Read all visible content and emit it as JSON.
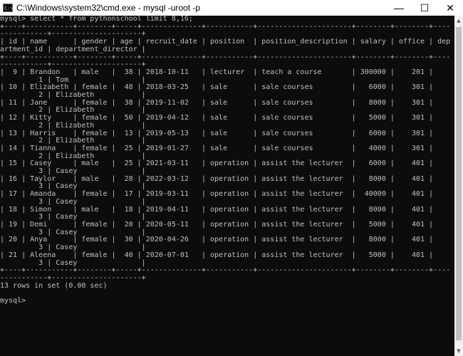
{
  "window": {
    "title": "C:\\Windows\\system32\\cmd.exe - mysql  -uroot -p",
    "icon_text": "C:\\",
    "minimize_glyph": "—",
    "maximize_glyph": "☐",
    "close_glyph": "✕"
  },
  "console": {
    "prompt": "mysql>",
    "command": "select * from pythonschool limit 8,16;",
    "columns": [
      "id",
      "name",
      "gender",
      "age",
      "recruit_date",
      "position",
      "position_description",
      "salary",
      "office",
      "department_id",
      "department_director"
    ],
    "rows": [
      [
        "9",
        "Brandon",
        "male",
        "38",
        "2018-10-11",
        "lecturer",
        "teach a course",
        "300000",
        "201",
        "1",
        "Tom"
      ],
      [
        "10",
        "Elizabeth",
        "female",
        "48",
        "2018-03-25",
        "sale",
        "sale courses",
        "6000",
        "301",
        "2",
        "Elizabeth"
      ],
      [
        "11",
        "Jane",
        "female",
        "38",
        "2019-11-02",
        "sale",
        "sale courses",
        "8000",
        "301",
        "2",
        "Elizabeth"
      ],
      [
        "12",
        "Kitty",
        "female",
        "50",
        "2019-04-12",
        "sale",
        "sale courses",
        "5000",
        "301",
        "2",
        "Elizabeth"
      ],
      [
        "13",
        "Harris",
        "female",
        "13",
        "2019-05-13",
        "sale",
        "sale courses",
        "6000",
        "301",
        "2",
        "Elizabeth"
      ],
      [
        "14",
        "Tianna",
        "female",
        "25",
        "2019-01-27",
        "sale",
        "sale courses",
        "4000",
        "301",
        "2",
        "Elizabeth"
      ],
      [
        "15",
        "Casey",
        "male",
        "25",
        "2021-03-11",
        "operation",
        "assist the lecturer",
        "6000",
        "401",
        "3",
        "Casey"
      ],
      [
        "16",
        "Taylor",
        "male",
        "28",
        "2022-03-12",
        "operation",
        "assist the lecturer",
        "8000",
        "401",
        "3",
        "Casey"
      ],
      [
        "17",
        "Amanda",
        "female",
        "17",
        "2019-03-11",
        "operation",
        "assist the lecturer",
        "40000",
        "401",
        "3",
        "Casey"
      ],
      [
        "18",
        "Simon",
        "male",
        "18",
        "2019-04-11",
        "operation",
        "assist the lecturer",
        "8000",
        "401",
        "3",
        "Casey"
      ],
      [
        "19",
        "Demi",
        "female",
        "20",
        "2020-05-11",
        "operation",
        "assist the lecturer",
        "5000",
        "401",
        "3",
        "Casey"
      ],
      [
        "20",
        "Anya",
        "female",
        "30",
        "2020-04-26",
        "operation",
        "assist the lecturer",
        "8000",
        "401",
        "3",
        "Casey"
      ],
      [
        "21",
        "Aleena",
        "female",
        "40",
        "2020-07-01",
        "operation",
        "assist the lecturer",
        "5000",
        "401",
        "3",
        "Casey"
      ]
    ],
    "result_message": "13 rows in set (0.00 sec)"
  },
  "colors": {
    "console_background": "#0c0c0c",
    "console_text": "#c0c0c0"
  }
}
